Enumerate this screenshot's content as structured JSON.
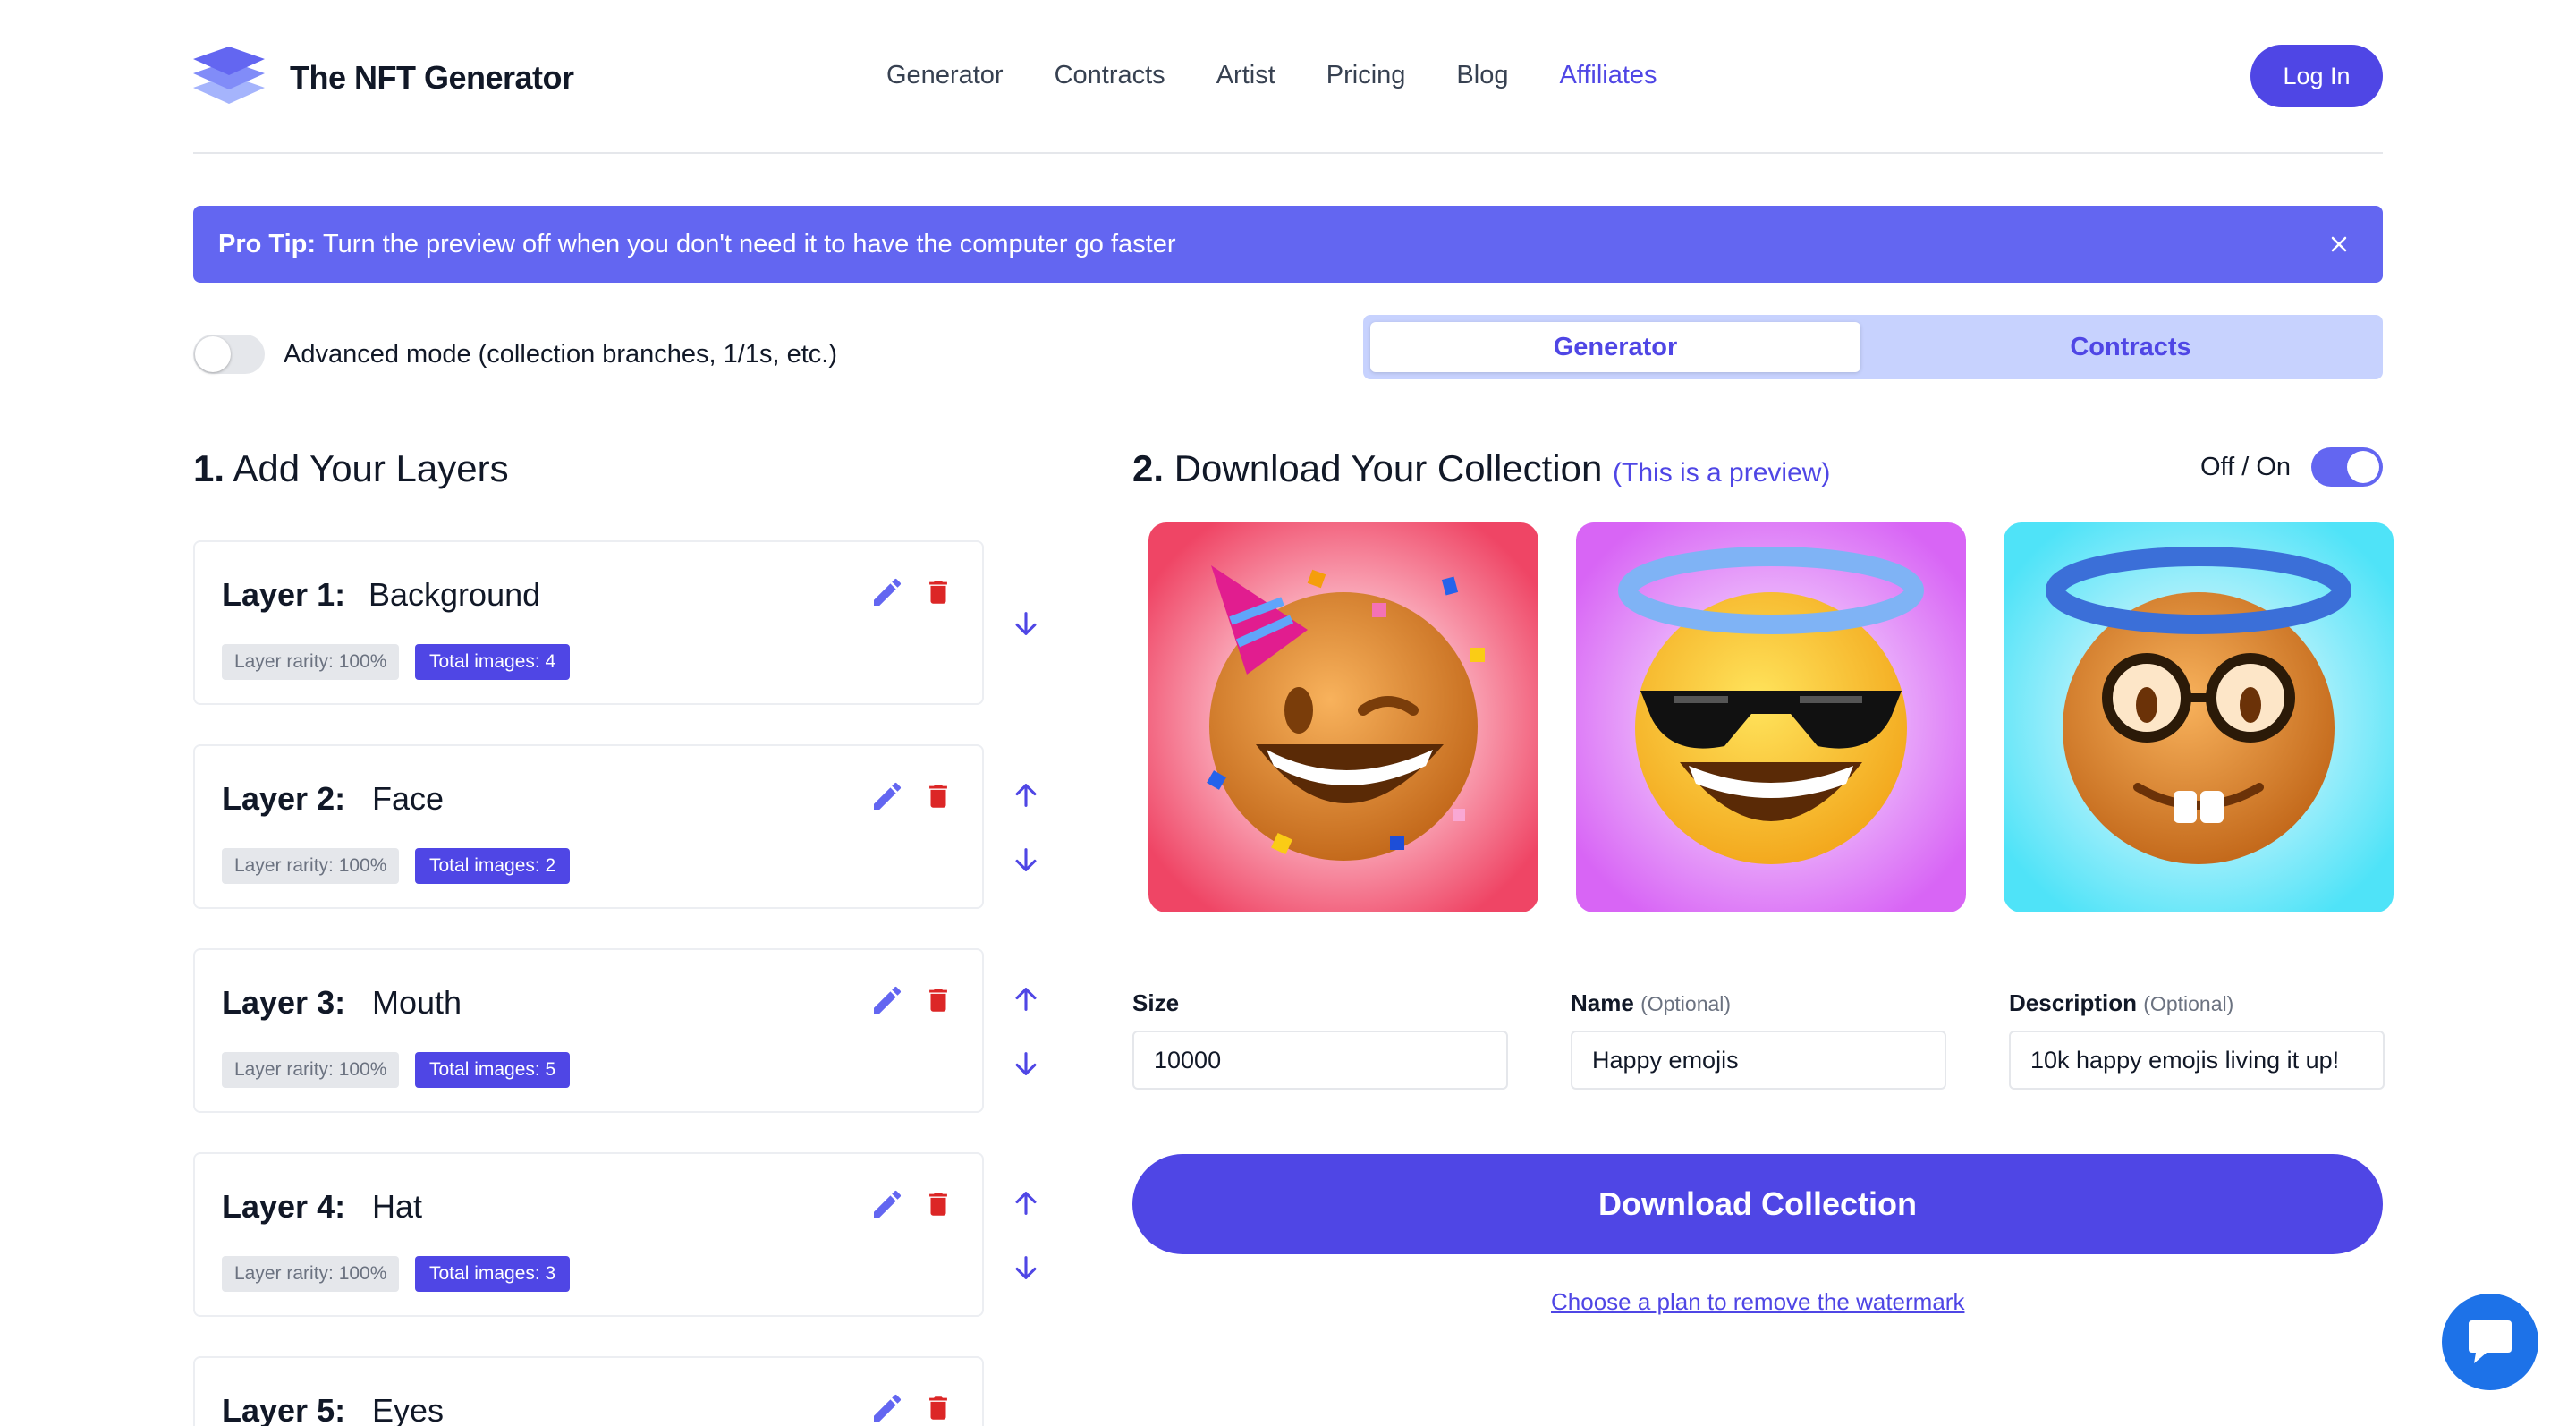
{
  "header": {
    "brand": "The NFT Generator",
    "nav": [
      "Generator",
      "Contracts",
      "Artist",
      "Pricing",
      "Blog",
      "Affiliates"
    ],
    "active_nav": "Affiliates",
    "login_label": "Log In"
  },
  "tip": {
    "bold": "Pro Tip:",
    "text": "Turn the preview off when you don't need it to have the computer go faster"
  },
  "advanced": {
    "label": "Advanced mode (collection branches, 1/1s, etc.)",
    "enabled": false
  },
  "tabs": {
    "generator": "Generator",
    "contracts": "Contracts",
    "selected": "Generator"
  },
  "left": {
    "num": "1.",
    "title": "Add Your Layers",
    "layers": [
      {
        "name": "Layer 1:",
        "value": "Background",
        "rarity": "Layer rarity: 100%",
        "total": "Total images: 4"
      },
      {
        "name": "Layer 2:",
        "value": "Face",
        "rarity": "Layer rarity: 100%",
        "total": "Total images: 2"
      },
      {
        "name": "Layer 3:",
        "value": "Mouth",
        "rarity": "Layer rarity: 100%",
        "total": "Total images: 5"
      },
      {
        "name": "Layer 4:",
        "value": "Hat",
        "rarity": "Layer rarity: 100%",
        "total": "Total images: 3"
      },
      {
        "name": "Layer 5:",
        "value": "Eyes",
        "rarity": "",
        "total": ""
      }
    ]
  },
  "right": {
    "num": "2.",
    "title": "Download Your Collection",
    "preview_note": "(This is a preview)",
    "toggle_label": "Off / On",
    "preview_on": true,
    "size_label": "Size",
    "size_value": "10000",
    "name_label": "Name",
    "name_optional": "(Optional)",
    "name_value": "Happy emojis",
    "desc_label": "Description",
    "desc_optional": "(Optional)",
    "desc_value": "10k happy emojis living it up!",
    "download_label": "Download Collection",
    "watermark_link": "Choose a plan to remove the watermark"
  },
  "colors": {
    "accent": "#4f46e5",
    "tip_bg": "#6366f1",
    "delete_red": "#dc2626",
    "preview_bg": [
      "#ef4565",
      "#d865f5",
      "#4fe3f8"
    ]
  },
  "icons": [
    "logo-icon",
    "close-icon",
    "pencil-icon",
    "trash-icon",
    "arrow-up-icon",
    "arrow-down-icon",
    "chat-icon"
  ]
}
